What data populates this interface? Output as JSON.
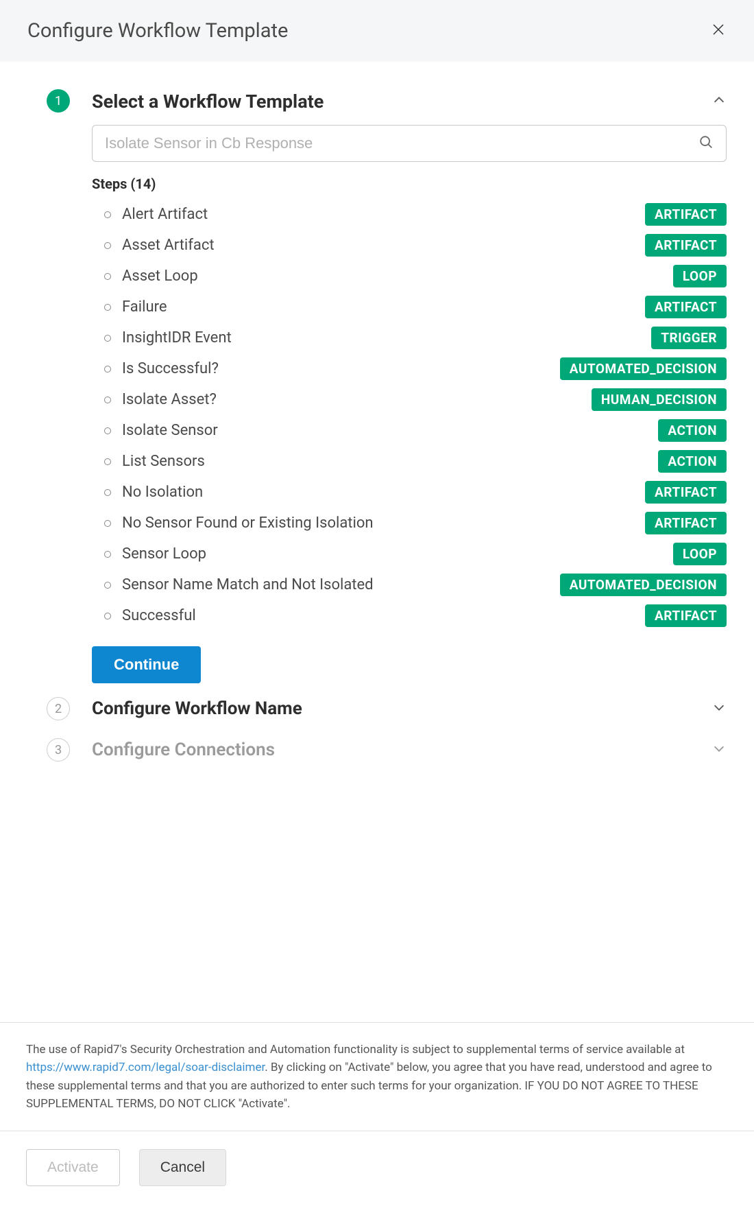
{
  "header": {
    "title": "Configure Workflow Template"
  },
  "wizard": {
    "step1": {
      "number": "1",
      "title": "Select a Workflow Template",
      "search_placeholder": "Isolate Sensor in Cb Response",
      "steps_label": "Steps (14)",
      "steps": [
        {
          "name": "Alert Artifact",
          "tag": "ARTIFACT"
        },
        {
          "name": "Asset Artifact",
          "tag": "ARTIFACT"
        },
        {
          "name": "Asset Loop",
          "tag": "LOOP"
        },
        {
          "name": "Failure",
          "tag": "ARTIFACT"
        },
        {
          "name": "InsightIDR Event",
          "tag": "TRIGGER"
        },
        {
          "name": "Is Successful?",
          "tag": "AUTOMATED_DECISION"
        },
        {
          "name": "Isolate Asset?",
          "tag": "HUMAN_DECISION"
        },
        {
          "name": "Isolate Sensor",
          "tag": "ACTION"
        },
        {
          "name": "List Sensors",
          "tag": "ACTION"
        },
        {
          "name": "No Isolation",
          "tag": "ARTIFACT"
        },
        {
          "name": "No Sensor Found or Existing Isolation",
          "tag": "ARTIFACT"
        },
        {
          "name": "Sensor Loop",
          "tag": "LOOP"
        },
        {
          "name": "Sensor Name Match and Not Isolated",
          "tag": "AUTOMATED_DECISION"
        },
        {
          "name": "Successful",
          "tag": "ARTIFACT"
        }
      ],
      "continue_label": "Continue"
    },
    "step2": {
      "number": "2",
      "title": "Configure Workflow Name"
    },
    "step3": {
      "number": "3",
      "title": "Configure Connections"
    }
  },
  "disclaimer": {
    "prefix": "The use of Rapid7's Security Orchestration and Automation functionality is subject to supplemental terms of service available at ",
    "link_text": "https://www.rapid7.com/legal/soar-disclaimer",
    "suffix": ". By clicking on \"Activate\" below, you agree that you have read, understood and agree to these supplemental terms and that you are authorized to enter such terms for your organization. IF YOU DO NOT AGREE TO THESE SUPPLEMENTAL TERMS, DO NOT CLICK \"Activate\"."
  },
  "actions": {
    "activate": "Activate",
    "cancel": "Cancel"
  }
}
